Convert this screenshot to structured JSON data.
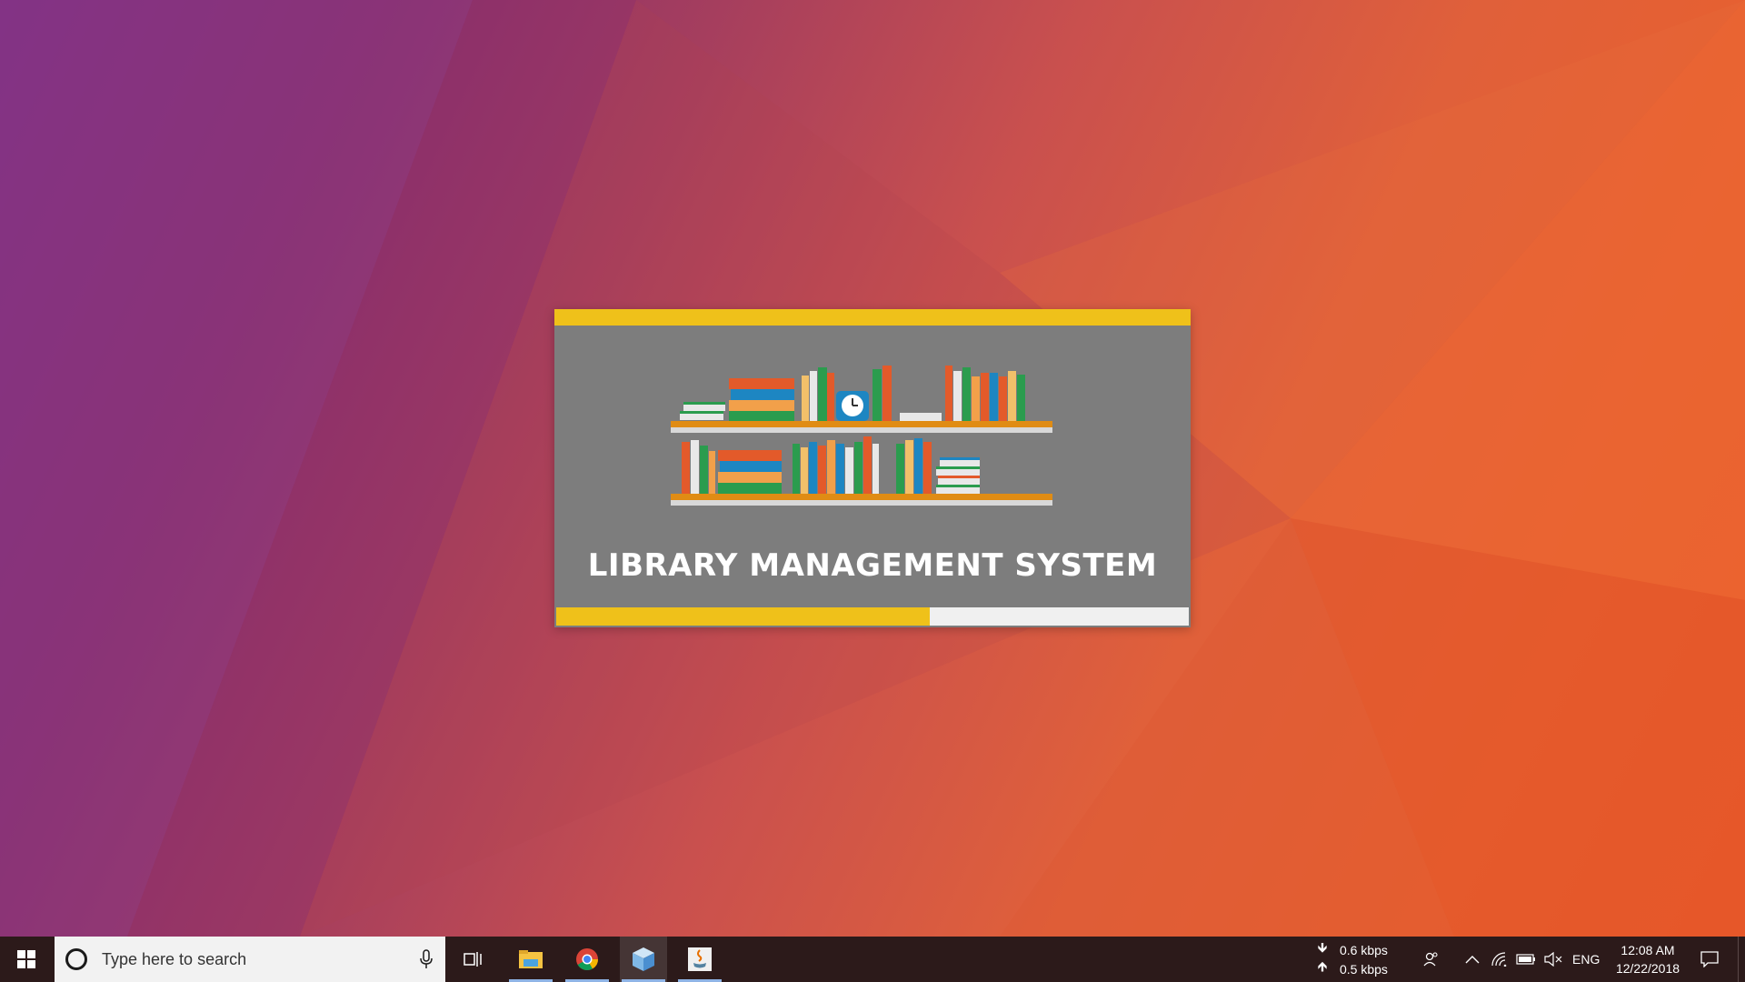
{
  "splash": {
    "title": "LIBRARY MANAGEMENT SYSTEM",
    "progress_fraction": 0.59,
    "accent_color": "#efc11a",
    "panel_color": "#7d7d7d"
  },
  "taskbar": {
    "search_placeholder": "Type here to search",
    "apps": [
      {
        "icon": "file-explorer-icon",
        "running": true,
        "active": false
      },
      {
        "icon": "chrome-icon",
        "running": true,
        "active": false
      },
      {
        "icon": "3d-box-app-icon",
        "running": true,
        "active": true
      },
      {
        "icon": "java-icon",
        "running": true,
        "active": false
      }
    ],
    "network_speed": {
      "download": "0.6 kbps",
      "upload": "0.5 kbps"
    },
    "language": "ENG",
    "time": "12:08 AM",
    "date": "12/22/2018",
    "tray_icons": [
      "people-icon",
      "chevron-up-icon",
      "wifi-icon",
      "battery-icon",
      "volume-muted-icon",
      "notification-icon"
    ]
  }
}
